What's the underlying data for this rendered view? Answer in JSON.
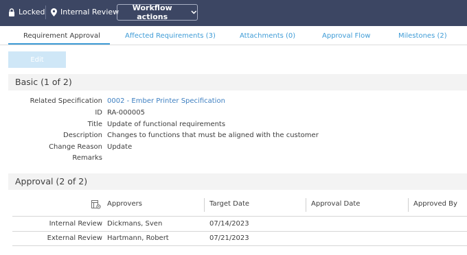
{
  "header": {
    "lock_label": "Locked",
    "location_label": "Internal Review",
    "workflow_button": "Workflow actions"
  },
  "tabs": [
    {
      "label": "Requirement Approval",
      "active": true
    },
    {
      "label": "Affected Requirements (3)"
    },
    {
      "label": "Attachments (0)"
    },
    {
      "label": "Approval Flow"
    },
    {
      "label": "Milestones (2)"
    }
  ],
  "toolbar": {
    "edit_label": "Edit"
  },
  "basic": {
    "title": "Basic (1 of 2)",
    "fields": [
      {
        "label": "Related Specification",
        "value": "0002 - Ember Printer Specification"
      },
      {
        "label": "ID",
        "value": "RA-000005"
      },
      {
        "label": "Title",
        "value": "Update of functional requirements"
      },
      {
        "label": "Description",
        "value": "Changes to functions that must be aligned with the customer"
      },
      {
        "label": "Change Reason",
        "value": "Update"
      },
      {
        "label": "Remarks",
        "value": ""
      }
    ]
  },
  "approval": {
    "title": "Approval (2 of 2)",
    "columns": [
      "Approvers",
      "Target Date",
      "Approval Date",
      "Approved By"
    ],
    "rows": [
      {
        "stage": "Internal Review",
        "approvers": "Dickmans, Sven",
        "target_date": "07/14/2023",
        "approval_date": "",
        "approved_by": ""
      },
      {
        "stage": "External Review",
        "approvers": "Hartmann, Robert",
        "target_date": "07/21/2023",
        "approval_date": "",
        "approved_by": ""
      }
    ]
  },
  "colors": {
    "header_bg": "#3c4663",
    "link": "#3d9bd6",
    "section_bg": "#f3f3f3",
    "edit_disabled": "#cfe7f7"
  }
}
